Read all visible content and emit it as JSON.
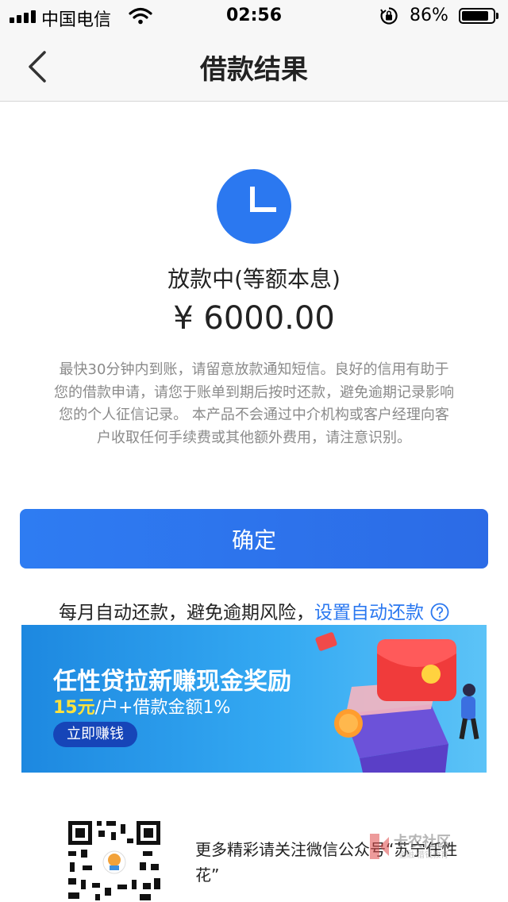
{
  "status_bar": {
    "carrier": "中国电信",
    "time": "02:56",
    "battery_percent": "86%",
    "battery_level": 0.86,
    "icons": [
      "signal-bars-icon",
      "wifi-icon",
      "orientation-lock-icon",
      "battery-icon"
    ]
  },
  "nav": {
    "title": "借款结果",
    "back_icon": "chevron-left-icon"
  },
  "result": {
    "status_icon": "clock-icon",
    "status_color": "#2b78f0",
    "status_text": "放款中(等额本息)",
    "amount": "¥ 6000.00",
    "notice": "最快30分钟内到账，请留意放款通知短信。良好的信用有助于您的借款申请，请您于账单到期后按时还款，避免逾期记录影响您的个人征信记录。 本产品不会通过中介机构或客户经理向客户收取任何手续费或其他额外费用，请注意识别。"
  },
  "confirm_button": {
    "label": "确定",
    "color": "#2e7cf2"
  },
  "auto_repay": {
    "text": "每月自动还款，避免逾期风险，",
    "link": "设置自动还款",
    "icon": "question-circle-icon"
  },
  "banner": {
    "title": "任性贷拉新赚现金奖励",
    "highlight": "15元",
    "subtitle_rest": "/户+借款金额1%",
    "button": "立即赚钱",
    "art_icon": "red-envelope-gift-box-icon"
  },
  "footer": {
    "follow_text": "更多精彩请关注微信公众号“苏宁任性花”",
    "qr_icon": "qr-code-icon",
    "watermark": "卡农社区",
    "watermark_sub": "金融·借钱教育"
  }
}
